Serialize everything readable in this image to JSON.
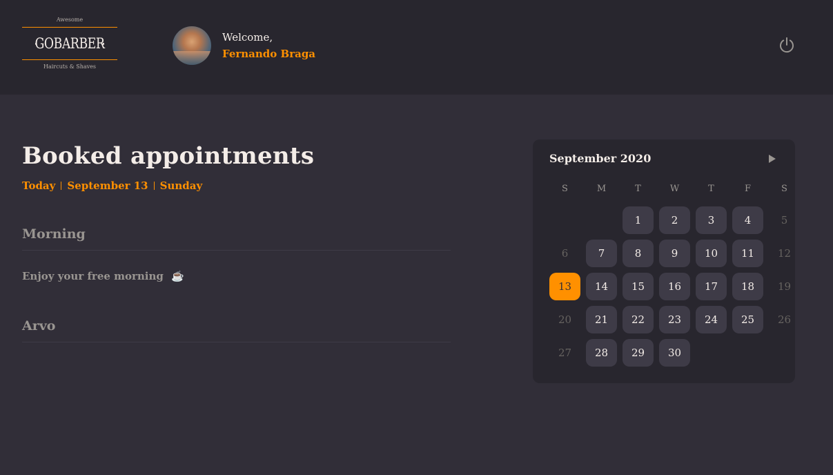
{
  "header": {
    "logo": {
      "top_text": "Awesome",
      "brand": "GOBARBER",
      "bottom_text": "Haircuts & Shaves"
    },
    "welcome_text": "Welcome,",
    "user_name": "Fernando Braga",
    "power_icon": "power-icon",
    "accent_color": "#ff9000"
  },
  "main": {
    "title": "Booked appointments",
    "date_info": {
      "today": "Today",
      "date": "September 13",
      "weekday": "Sunday"
    },
    "morning": {
      "title": "Morning",
      "empty_text": "Enjoy your free morning",
      "icon": "☕"
    },
    "afternoon": {
      "title": "Arvo"
    }
  },
  "calendar": {
    "month_label": "September 2020",
    "next_icon": "next-month-icon",
    "weekdays": [
      "S",
      "M",
      "T",
      "W",
      "T",
      "F",
      "S"
    ],
    "selected_day": 13,
    "weeks": [
      [
        null,
        null,
        1,
        2,
        3,
        4,
        5
      ],
      [
        6,
        7,
        8,
        9,
        10,
        11,
        12
      ],
      [
        13,
        14,
        15,
        16,
        17,
        18,
        19
      ],
      [
        20,
        21,
        22,
        23,
        24,
        25,
        26
      ],
      [
        27,
        28,
        29,
        30,
        null,
        null,
        null
      ]
    ],
    "disabled_days": [
      5,
      6,
      12,
      19,
      20,
      26,
      27
    ]
  }
}
